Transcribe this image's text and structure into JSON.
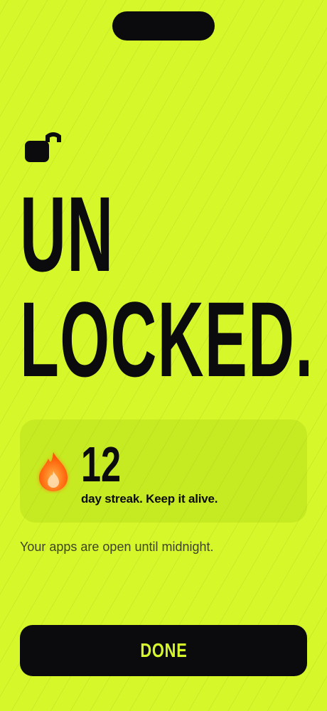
{
  "screen": {
    "background_color": "#D6F82A",
    "text_color": "#0B0B0D"
  },
  "hero": {
    "line1": "UN",
    "line2": "LOCKED.",
    "icon": "unlocked-padlock-icon"
  },
  "streak": {
    "count": "12",
    "caption": "day streak. Keep it alive.",
    "icon": "flame-icon",
    "flame_color": "#FF6A00"
  },
  "subtext": "Your apps are open until midnight.",
  "done_button": {
    "label": "DONE"
  }
}
